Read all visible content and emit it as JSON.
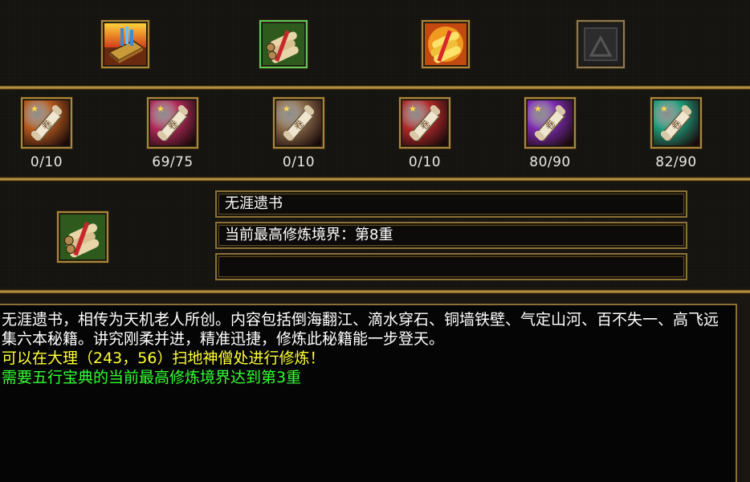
{
  "top_items": [
    {
      "name": "book-stack-item-icon"
    },
    {
      "name": "green-scroll-bundle-item-icon"
    },
    {
      "name": "golden-scroll-bundle-item-icon"
    },
    {
      "name": "empty-item-slot-icon"
    }
  ],
  "scrolls": [
    {
      "icon": "orange-scroll-icon",
      "progress": "0/10",
      "color": "#b35a1e"
    },
    {
      "icon": "rose-scroll-icon",
      "progress": "69/75",
      "color": "#b02a5a"
    },
    {
      "icon": "tan-scroll-icon",
      "progress": "0/10",
      "color": "#8a6a48"
    },
    {
      "icon": "red-scroll-icon",
      "progress": "0/10",
      "color": "#b02a2a"
    },
    {
      "icon": "purple-scroll-icon",
      "progress": "80/90",
      "color": "#7a2ab0"
    },
    {
      "icon": "teal-scroll-icon",
      "progress": "82/90",
      "color": "#1e9a7a"
    }
  ],
  "detail": {
    "book_name": "无涯遗书",
    "level_text": "当前最高修炼境界：第8重",
    "empty_field": ""
  },
  "description": {
    "body": "无涯遗书，相传为天机老人所创。内容包括倒海翻江、滴水穿石、铜墙铁壁、气定山河、百不失一、高飞远集六本秘籍。讲究刚柔并进，精准迅捷，修炼此秘籍能一步登天。",
    "location_hint": "可以在大理（243，56）扫地神僧处进行修炼！",
    "requirement": "需要五行宝典的当前最高修炼境界达到第3重"
  },
  "colors": {
    "gold_border": "#a8873e",
    "hint_yellow": "#ffff33",
    "requirement_green": "#33ff33"
  }
}
